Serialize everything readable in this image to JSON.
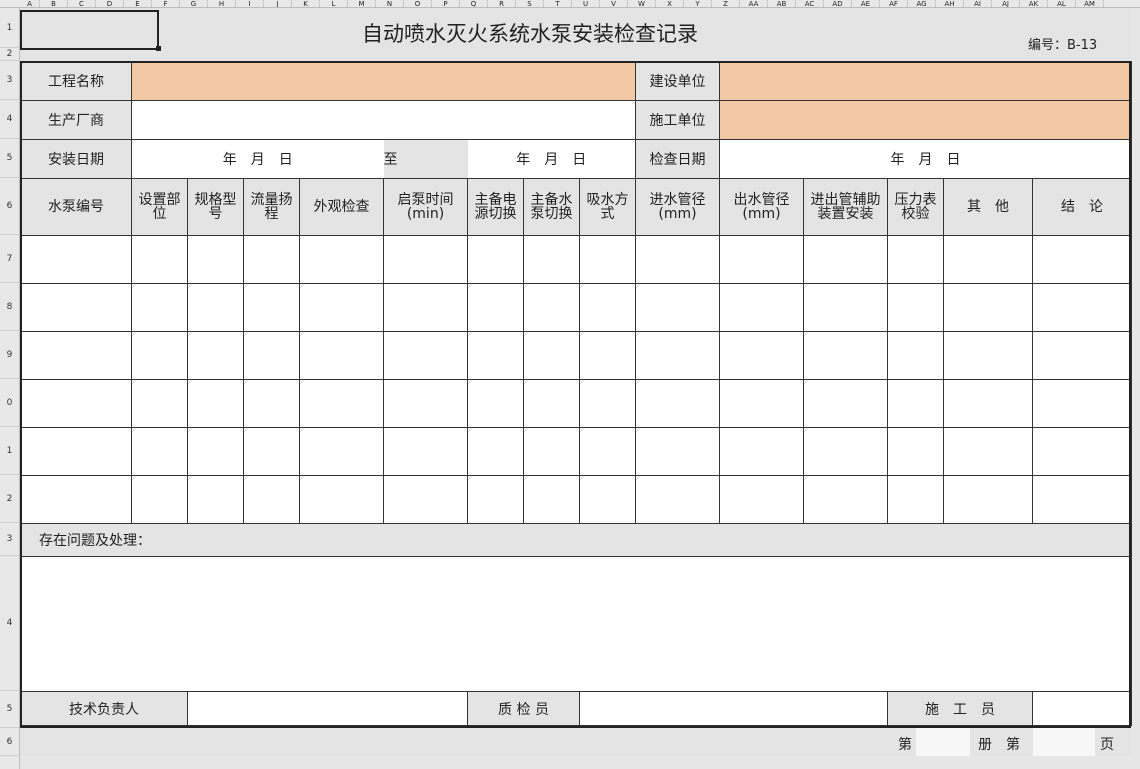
{
  "column_headers": [
    "A",
    "B",
    "C",
    "D",
    "E",
    "F",
    "G",
    "H",
    "I",
    "J",
    "K",
    "L",
    "M",
    "N",
    "O",
    "P",
    "Q",
    "R",
    "S",
    "T",
    "U",
    "V",
    "W",
    "X",
    "Y",
    "Z",
    "AA",
    "AB",
    "AC",
    "AD",
    "AE",
    "AF",
    "AG",
    "AH",
    "AI",
    "AJ",
    "AK",
    "AL",
    "AM"
  ],
  "row_headers": [
    "1",
    "2",
    "3",
    "4",
    "5",
    "6",
    "7",
    "8",
    "9",
    "0",
    "1",
    "2",
    "3",
    "4",
    "5",
    "6"
  ],
  "form": {
    "title": "自动喷水灭火系统水泵安装检查记录",
    "code": "编号：B-13",
    "project_name_label": "工程名称",
    "construction_unit_label": "建设单位",
    "manufacturer_label": "生产厂商",
    "contractor_label": "施工单位",
    "install_date_label": "安装日期",
    "date_placeholder": "年　月　日",
    "to_label": "至",
    "inspect_date_label": "检查日期",
    "columns": [
      "水泵编号",
      "设置部位",
      "规格型号",
      "流量扬程",
      "外观检查",
      "启泵时间(min)",
      "主备电源切换",
      "主备水泵切换",
      "吸水方式",
      "进水管径(mm)",
      "出水管径(mm)",
      "进出管辅助装置安装",
      "压力表校验",
      "其　他",
      "结　论"
    ],
    "problems_label": "存在问题及处理：",
    "tech_lead_label": "技术负责人",
    "inspector_label": "质 检 员",
    "worker_label": "施　工　员",
    "footer_page_label": "第",
    "footer_volume_label": "册　第",
    "footer_end_label": "页"
  }
}
